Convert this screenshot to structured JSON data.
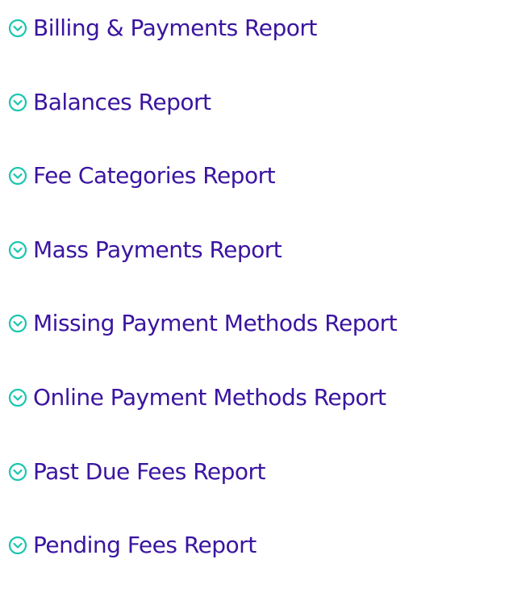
{
  "colors": {
    "label": "#3a14a0",
    "icon": "#19c6b0"
  },
  "reports": {
    "items": [
      {
        "label": "Billing & Payments Report",
        "icon": "chevron-down-circle-icon"
      },
      {
        "label": "Balances Report",
        "icon": "chevron-down-circle-icon"
      },
      {
        "label": "Fee Categories Report",
        "icon": "chevron-down-circle-icon"
      },
      {
        "label": "Mass Payments Report",
        "icon": "chevron-down-circle-icon"
      },
      {
        "label": "Missing Payment Methods Report",
        "icon": "chevron-down-circle-icon"
      },
      {
        "label": "Online Payment Methods Report",
        "icon": "chevron-down-circle-icon"
      },
      {
        "label": "Past Due Fees Report",
        "icon": "chevron-down-circle-icon"
      },
      {
        "label": "Pending Fees Report",
        "icon": "chevron-down-circle-icon"
      }
    ]
  }
}
